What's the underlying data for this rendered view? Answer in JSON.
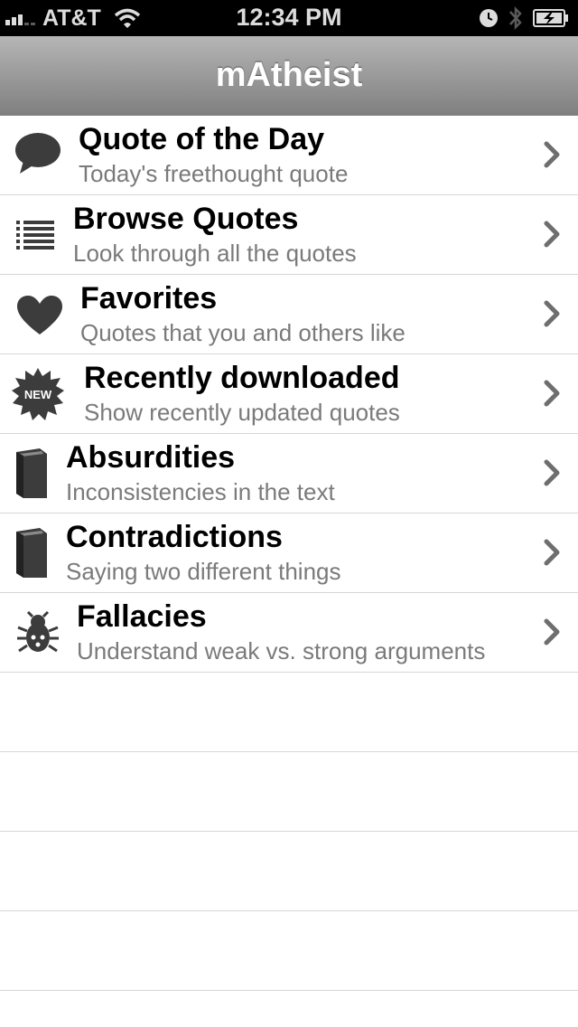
{
  "status_bar": {
    "carrier": "AT&T",
    "time": "12:34 PM"
  },
  "nav": {
    "title": "mAtheist"
  },
  "menu": [
    {
      "title": "Quote of the Day",
      "subtitle": "Today's freethought quote",
      "icon": "speech-bubble-icon"
    },
    {
      "title": "Browse Quotes",
      "subtitle": "Look through all the quotes",
      "icon": "list-icon"
    },
    {
      "title": "Favorites",
      "subtitle": "Quotes that you and others like",
      "icon": "heart-icon"
    },
    {
      "title": "Recently downloaded",
      "subtitle": "Show recently updated quotes",
      "icon": "new-badge-icon",
      "badge_text": "NEW"
    },
    {
      "title": "Absurdities",
      "subtitle": "Inconsistencies in the text",
      "icon": "book-icon"
    },
    {
      "title": "Contradictions",
      "subtitle": "Saying two different things",
      "icon": "book-icon"
    },
    {
      "title": "Fallacies",
      "subtitle": "Understand weak vs. strong arguments",
      "icon": "bug-icon"
    }
  ],
  "colors": {
    "status_bar_bg": "#000000",
    "nav_gradient_top": "#b6b6b6",
    "nav_gradient_bottom": "#7f7f7f",
    "icon": "#3c3c3c",
    "chevron": "#6e6e6e",
    "subtitle": "#7a7a7a",
    "separator": "#d6d6d6"
  }
}
